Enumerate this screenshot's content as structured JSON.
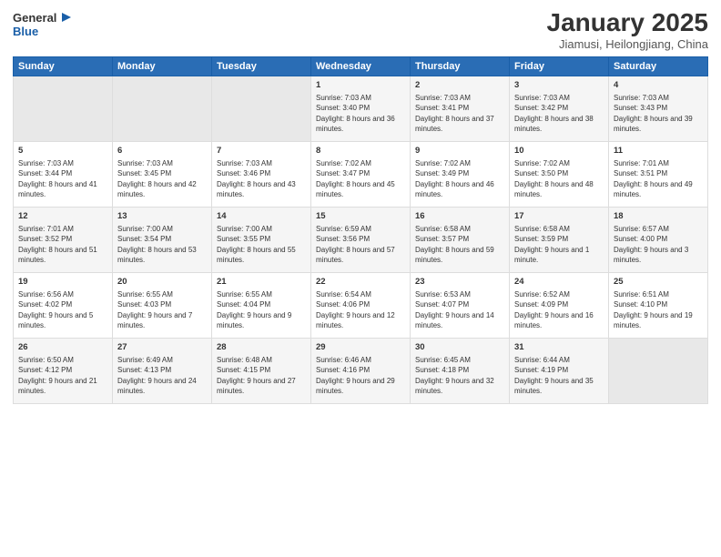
{
  "header": {
    "logo_general": "General",
    "logo_blue": "Blue",
    "title": "January 2025",
    "subtitle": "Jiamusi, Heilongjiang, China"
  },
  "days_of_week": [
    "Sunday",
    "Monday",
    "Tuesday",
    "Wednesday",
    "Thursday",
    "Friday",
    "Saturday"
  ],
  "weeks": [
    [
      {
        "day": "",
        "empty": true
      },
      {
        "day": "",
        "empty": true
      },
      {
        "day": "",
        "empty": true
      },
      {
        "day": "1",
        "sunrise": "7:03 AM",
        "sunset": "3:40 PM",
        "daylight": "8 hours and 36 minutes."
      },
      {
        "day": "2",
        "sunrise": "7:03 AM",
        "sunset": "3:41 PM",
        "daylight": "8 hours and 37 minutes."
      },
      {
        "day": "3",
        "sunrise": "7:03 AM",
        "sunset": "3:42 PM",
        "daylight": "8 hours and 38 minutes."
      },
      {
        "day": "4",
        "sunrise": "7:03 AM",
        "sunset": "3:43 PM",
        "daylight": "8 hours and 39 minutes."
      }
    ],
    [
      {
        "day": "5",
        "sunrise": "7:03 AM",
        "sunset": "3:44 PM",
        "daylight": "8 hours and 41 minutes."
      },
      {
        "day": "6",
        "sunrise": "7:03 AM",
        "sunset": "3:45 PM",
        "daylight": "8 hours and 42 minutes."
      },
      {
        "day": "7",
        "sunrise": "7:03 AM",
        "sunset": "3:46 PM",
        "daylight": "8 hours and 43 minutes."
      },
      {
        "day": "8",
        "sunrise": "7:02 AM",
        "sunset": "3:47 PM",
        "daylight": "8 hours and 45 minutes."
      },
      {
        "day": "9",
        "sunrise": "7:02 AM",
        "sunset": "3:49 PM",
        "daylight": "8 hours and 46 minutes."
      },
      {
        "day": "10",
        "sunrise": "7:02 AM",
        "sunset": "3:50 PM",
        "daylight": "8 hours and 48 minutes."
      },
      {
        "day": "11",
        "sunrise": "7:01 AM",
        "sunset": "3:51 PM",
        "daylight": "8 hours and 49 minutes."
      }
    ],
    [
      {
        "day": "12",
        "sunrise": "7:01 AM",
        "sunset": "3:52 PM",
        "daylight": "8 hours and 51 minutes."
      },
      {
        "day": "13",
        "sunrise": "7:00 AM",
        "sunset": "3:54 PM",
        "daylight": "8 hours and 53 minutes."
      },
      {
        "day": "14",
        "sunrise": "7:00 AM",
        "sunset": "3:55 PM",
        "daylight": "8 hours and 55 minutes."
      },
      {
        "day": "15",
        "sunrise": "6:59 AM",
        "sunset": "3:56 PM",
        "daylight": "8 hours and 57 minutes."
      },
      {
        "day": "16",
        "sunrise": "6:58 AM",
        "sunset": "3:57 PM",
        "daylight": "8 hours and 59 minutes."
      },
      {
        "day": "17",
        "sunrise": "6:58 AM",
        "sunset": "3:59 PM",
        "daylight": "9 hours and 1 minute."
      },
      {
        "day": "18",
        "sunrise": "6:57 AM",
        "sunset": "4:00 PM",
        "daylight": "9 hours and 3 minutes."
      }
    ],
    [
      {
        "day": "19",
        "sunrise": "6:56 AM",
        "sunset": "4:02 PM",
        "daylight": "9 hours and 5 minutes."
      },
      {
        "day": "20",
        "sunrise": "6:55 AM",
        "sunset": "4:03 PM",
        "daylight": "9 hours and 7 minutes."
      },
      {
        "day": "21",
        "sunrise": "6:55 AM",
        "sunset": "4:04 PM",
        "daylight": "9 hours and 9 minutes."
      },
      {
        "day": "22",
        "sunrise": "6:54 AM",
        "sunset": "4:06 PM",
        "daylight": "9 hours and 12 minutes."
      },
      {
        "day": "23",
        "sunrise": "6:53 AM",
        "sunset": "4:07 PM",
        "daylight": "9 hours and 14 minutes."
      },
      {
        "day": "24",
        "sunrise": "6:52 AM",
        "sunset": "4:09 PM",
        "daylight": "9 hours and 16 minutes."
      },
      {
        "day": "25",
        "sunrise": "6:51 AM",
        "sunset": "4:10 PM",
        "daylight": "9 hours and 19 minutes."
      }
    ],
    [
      {
        "day": "26",
        "sunrise": "6:50 AM",
        "sunset": "4:12 PM",
        "daylight": "9 hours and 21 minutes."
      },
      {
        "day": "27",
        "sunrise": "6:49 AM",
        "sunset": "4:13 PM",
        "daylight": "9 hours and 24 minutes."
      },
      {
        "day": "28",
        "sunrise": "6:48 AM",
        "sunset": "4:15 PM",
        "daylight": "9 hours and 27 minutes."
      },
      {
        "day": "29",
        "sunrise": "6:46 AM",
        "sunset": "4:16 PM",
        "daylight": "9 hours and 29 minutes."
      },
      {
        "day": "30",
        "sunrise": "6:45 AM",
        "sunset": "4:18 PM",
        "daylight": "9 hours and 32 minutes."
      },
      {
        "day": "31",
        "sunrise": "6:44 AM",
        "sunset": "4:19 PM",
        "daylight": "9 hours and 35 minutes."
      },
      {
        "day": "",
        "empty": true
      }
    ]
  ]
}
